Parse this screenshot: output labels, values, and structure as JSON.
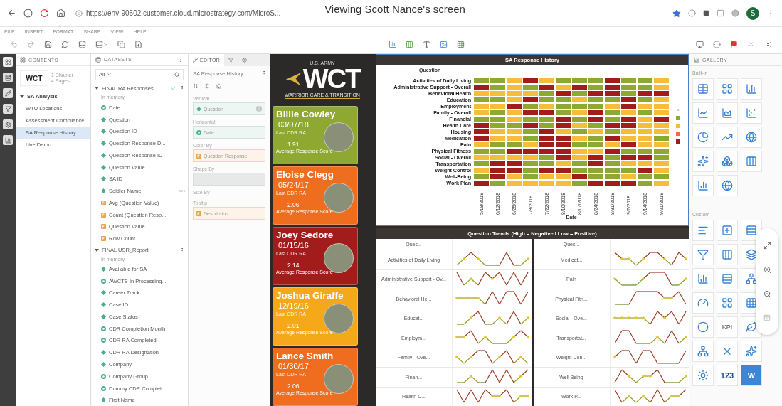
{
  "browser": {
    "url": "https://env-90502.customer.cloud.microstrategy.com/MicroS...",
    "share_banner": "Viewing Scott Nance's screen",
    "avatar": "S"
  },
  "menu": [
    "FILE",
    "INSERT",
    "FORMAT",
    "SHARE",
    "VIEW",
    "HELP"
  ],
  "contents": {
    "title": "CONTENTS",
    "thumbnail_text": "WCT",
    "chapters": "1 Chapter",
    "pages": "4 Pages",
    "tree": [
      {
        "label": "SA Analysis",
        "expanded": true,
        "selected": false,
        "children": [
          {
            "label": "WTU Locations",
            "selected": false
          },
          {
            "label": "Assessment Compliance",
            "selected": false
          },
          {
            "label": "SA Response History",
            "selected": true
          },
          {
            "label": "Live Demo",
            "selected": false
          }
        ]
      }
    ]
  },
  "datasets": {
    "title": "DATASETS",
    "filter": "All",
    "groups": [
      {
        "name": "FINAL RA Responses",
        "status": "In memory",
        "expanded": true,
        "in_use": true,
        "children": [
          {
            "label": "Date",
            "kind": "derived",
            "hovered": false
          },
          {
            "label": "Question",
            "kind": "attribute",
            "hovered": false
          },
          {
            "label": "Question ID",
            "kind": "attribute",
            "hovered": false
          },
          {
            "label": "Question Response D...",
            "kind": "attribute",
            "hovered": false
          },
          {
            "label": "Question Response ID",
            "kind": "attribute",
            "hovered": false
          },
          {
            "label": "Question Value",
            "kind": "attribute",
            "hovered": false
          },
          {
            "label": "SA ID",
            "kind": "attribute",
            "hovered": false
          },
          {
            "label": "Soldier Name",
            "kind": "attribute",
            "hovered": true
          },
          {
            "label": "Avg (Question Value)",
            "kind": "metric",
            "hovered": false
          },
          {
            "label": "Count (Question Resp...",
            "kind": "metric",
            "hovered": false
          },
          {
            "label": "Question Value",
            "kind": "metric",
            "hovered": false
          },
          {
            "label": "Row Count",
            "kind": "metric",
            "hovered": false
          }
        ]
      },
      {
        "name": "FINAL USR_Report",
        "status": "In memory",
        "expanded": true,
        "in_use": false,
        "children": [
          {
            "label": "Available for SA",
            "kind": "attribute",
            "hovered": false
          },
          {
            "label": "AWCTS In Processing...",
            "kind": "derived",
            "hovered": false
          },
          {
            "label": "Career Track",
            "kind": "attribute",
            "hovered": false
          },
          {
            "label": "Case ID",
            "kind": "attribute",
            "hovered": false
          },
          {
            "label": "Case Status",
            "kind": "attribute",
            "hovered": false
          },
          {
            "label": "CDR Completion Month",
            "kind": "derived",
            "hovered": false
          },
          {
            "label": "CDR RA Completed",
            "kind": "derived",
            "hovered": false
          },
          {
            "label": "CDR RA Designation",
            "kind": "attribute",
            "hovered": false
          },
          {
            "label": "Company",
            "kind": "attribute",
            "hovered": false
          },
          {
            "label": "Company Group",
            "kind": "derived",
            "hovered": false
          },
          {
            "label": "Dummy CDR Complet...",
            "kind": "derived",
            "hovered": false
          },
          {
            "label": "First Name",
            "kind": "attribute",
            "hovered": false
          }
        ]
      }
    ]
  },
  "editor": {
    "tab": "EDITOR",
    "viz_name": "SA Response History",
    "zones": [
      {
        "label": "Vertical",
        "kind": "attribute",
        "value": "Question"
      },
      {
        "label": "Horizontal",
        "kind": "derived",
        "value": "Date"
      },
      {
        "label": "Color By",
        "kind": "metric",
        "value": "Question Response"
      },
      {
        "label": "Shape By",
        "kind": "empty"
      },
      {
        "label": "Size By",
        "kind": "none"
      },
      {
        "label": "Tooltip",
        "kind": "metric",
        "value": "Description"
      }
    ]
  },
  "logo": {
    "top": "U.S. ARMY",
    "mark": "WCT",
    "bottom": "WARRIOR CARE & TRANSITION"
  },
  "cards": [
    {
      "name": "Billie Cowley",
      "date": "03/07/18",
      "date_label": "Last CDR RA",
      "score": "1.91",
      "score_label": "Average Response Score",
      "color": "#8fa832"
    },
    {
      "name": "Eloise Clegg",
      "date": "05/24/17",
      "date_label": "Last CDR RA",
      "score": "2.06",
      "score_label": "Average Response Score",
      "color": "#ee6d1e"
    },
    {
      "name": "Joey Sedore",
      "date": "01/15/16",
      "date_label": "Last CDR RA",
      "score": "2.14",
      "score_label": "Average Response Score",
      "color": "#a21c1c"
    },
    {
      "name": "Joshua Giraffe",
      "date": "12/19/16",
      "date_label": "Last CDR RA",
      "score": "2.01",
      "score_label": "Average Response Score",
      "color": "#f4a81a"
    },
    {
      "name": "Lance Smith",
      "date": "01/30/17",
      "date_label": "Last CDR RA",
      "score": "2.06",
      "score_label": "Average Response Score",
      "color": "#ee6d1e"
    }
  ],
  "heatmap": {
    "title": "SA Response History",
    "row_header": "Question",
    "x_title": "Date",
    "legend_toggle": "«",
    "legend": [
      {
        "color": "#8fa832"
      },
      {
        "color": "#f6bd3c"
      },
      {
        "color": "#e9742a"
      },
      {
        "color": "#a21c1c"
      }
    ],
    "dates": [
      "5/18/2018",
      "6/12/2018",
      "6/25/2018",
      "7/8/2018",
      "7/22/2018",
      "8/10/2018",
      "8/17/2018",
      "8/24/2018",
      "8/31/2018",
      "9/7/2018",
      "9/14/2018",
      "9/21/2018"
    ],
    "rows": [
      {
        "label": "Activities of Daily Living",
        "cells": [
          {
            "color": "#8fa832"
          },
          {
            "color": "#8fa832"
          },
          {
            "color": "#f6bd3c"
          },
          {
            "color": "#a21c1c"
          },
          {
            "color": "#f6bd3c"
          },
          {
            "color": "#8fa832"
          },
          {
            "color": "#8fa832"
          },
          {
            "color": "#8fa832"
          },
          {
            "color": "#a21c1c"
          },
          {
            "color": "#8fa832"
          },
          {
            "color": "#8fa832"
          },
          {
            "color": "#f6bd3c"
          }
        ]
      },
      {
        "label": "Administrative Support - Overall",
        "cells": [
          {
            "color": "#a21c1c"
          },
          {
            "color": "#8fa832"
          },
          {
            "color": "#f6bd3c"
          },
          {
            "color": "#8fa832"
          },
          {
            "color": "#a21c1c"
          },
          {
            "color": "#f6bd3c"
          },
          {
            "color": "#a21c1c"
          },
          {
            "color": "#8fa832"
          },
          {
            "color": "#a21c1c"
          },
          {
            "color": "#8fa832"
          },
          {
            "color": "#8fa832"
          },
          {
            "color": "#f6bd3c"
          }
        ]
      },
      {
        "label": "Behavioral Health",
        "cells": [
          {
            "color": "#f6bd3c"
          },
          {
            "color": "#f6bd3c"
          },
          {
            "color": "#f6bd3c"
          },
          {
            "color": "#f6bd3c"
          },
          {
            "color": "#8fa832"
          },
          {
            "color": "#a21c1c"
          },
          {
            "color": "#8fa832"
          },
          {
            "color": "#a21c1c"
          },
          {
            "color": "#a21c1c"
          },
          {
            "color": "#8fa832"
          },
          {
            "color": "#a21c1c"
          },
          {
            "color": "#a21c1c"
          }
        ]
      },
      {
        "label": "Education",
        "cells": [
          {
            "color": "#8fa832"
          },
          {
            "color": "#8fa832"
          },
          {
            "color": "#f6bd3c"
          },
          {
            "color": "#a21c1c"
          },
          {
            "color": "#8fa832"
          },
          {
            "color": "#8fa832"
          },
          {
            "color": "#f6bd3c"
          },
          {
            "color": "#8fa832"
          },
          {
            "color": "#8fa832"
          },
          {
            "color": "#a21c1c"
          },
          {
            "color": "#8fa832"
          },
          {
            "color": "#f6bd3c"
          }
        ]
      },
      {
        "label": "Employment",
        "cells": [
          {
            "color": "#f6bd3c"
          },
          {
            "color": "#f6bd3c"
          },
          {
            "color": "#a21c1c"
          },
          {
            "color": "#8fa832"
          },
          {
            "color": "#f6bd3c"
          },
          {
            "color": "#8fa832"
          },
          {
            "color": "#8fa832"
          },
          {
            "color": "#8fa832"
          },
          {
            "color": "#f6bd3c"
          },
          {
            "color": "#a21c1c"
          },
          {
            "color": "#f6bd3c"
          },
          {
            "color": "#f6bd3c"
          }
        ]
      },
      {
        "label": "Family - Overall",
        "cells": [
          {
            "color": "#f6bd3c"
          },
          {
            "color": "#8fa832"
          },
          {
            "color": "#f6bd3c"
          },
          {
            "color": "#a21c1c"
          },
          {
            "color": "#a21c1c"
          },
          {
            "color": "#8fa832"
          },
          {
            "color": "#f6bd3c"
          },
          {
            "color": "#a21c1c"
          },
          {
            "color": "#8fa832"
          },
          {
            "color": "#f6bd3c"
          },
          {
            "color": "#8fa832"
          },
          {
            "color": "#f6bd3c"
          }
        ]
      },
      {
        "label": "Financial",
        "cells": [
          {
            "color": "#8fa832"
          },
          {
            "color": "#8fa832"
          },
          {
            "color": "#f6bd3c"
          },
          {
            "color": "#8fa832"
          },
          {
            "color": "#8fa832"
          },
          {
            "color": "#a21c1c"
          },
          {
            "color": "#8fa832"
          },
          {
            "color": "#a21c1c"
          },
          {
            "color": "#8fa832"
          },
          {
            "color": "#a21c1c"
          },
          {
            "color": "#f6bd3c"
          },
          {
            "color": "#a21c1c"
          }
        ]
      },
      {
        "label": "Health Care",
        "cells": [
          {
            "color": "#a21c1c"
          },
          {
            "color": "#8fa832"
          },
          {
            "color": "#8fa832"
          },
          {
            "color": "#a21c1c"
          },
          {
            "color": "#8fa832"
          },
          {
            "color": "#a21c1c"
          },
          {
            "color": "#f6bd3c"
          },
          {
            "color": "#8fa832"
          },
          {
            "color": "#a21c1c"
          },
          {
            "color": "#a21c1c"
          },
          {
            "color": "#f6bd3c"
          },
          {
            "color": "#f6bd3c"
          }
        ]
      },
      {
        "label": "Housing",
        "cells": [
          {
            "color": "#a21c1c"
          },
          {
            "color": "#f6bd3c"
          },
          {
            "color": "#f6bd3c"
          },
          {
            "color": "#8fa832"
          },
          {
            "color": "#a21c1c"
          },
          {
            "color": "#f6bd3c"
          },
          {
            "color": "#8fa832"
          },
          {
            "color": "#f6bd3c"
          },
          {
            "color": "#8fa832"
          },
          {
            "color": "#f6bd3c"
          },
          {
            "color": "#f6bd3c"
          },
          {
            "color": "#f6bd3c"
          }
        ]
      },
      {
        "label": "Medication",
        "cells": [
          {
            "color": "#a21c1c"
          },
          {
            "color": "#f6bd3c"
          },
          {
            "color": "#f6bd3c"
          },
          {
            "color": "#8fa832"
          },
          {
            "color": "#a21c1c"
          },
          {
            "color": "#a21c1c"
          },
          {
            "color": "#f6bd3c"
          },
          {
            "color": "#8fa832"
          },
          {
            "color": "#a21c1c"
          },
          {
            "color": "#f6bd3c"
          },
          {
            "color": "#f6bd3c"
          },
          {
            "color": "#8fa832"
          }
        ]
      },
      {
        "label": "Pain",
        "cells": [
          {
            "color": "#f6bd3c"
          },
          {
            "color": "#8fa832"
          },
          {
            "color": "#8fa832"
          },
          {
            "color": "#f6bd3c"
          },
          {
            "color": "#a21c1c"
          },
          {
            "color": "#a21c1c"
          },
          {
            "color": "#8fa832"
          },
          {
            "color": "#8fa832"
          },
          {
            "color": "#f6bd3c"
          },
          {
            "color": "#a21c1c"
          },
          {
            "color": "#f6bd3c"
          },
          {
            "color": "#f6bd3c"
          }
        ]
      },
      {
        "label": "Physical Fitness",
        "cells": [
          {
            "color": "#8fa832"
          },
          {
            "color": "#8fa832"
          },
          {
            "color": "#a21c1c"
          },
          {
            "color": "#a21c1c"
          },
          {
            "color": "#a21c1c"
          },
          {
            "color": "#a21c1c"
          },
          {
            "color": "#f6bd3c"
          },
          {
            "color": "#f6bd3c"
          },
          {
            "color": "#a21c1c"
          },
          {
            "color": "#8fa832"
          },
          {
            "color": "#8fa832"
          },
          {
            "color": "#8fa832"
          }
        ]
      },
      {
        "label": "Social - Overall",
        "cells": [
          {
            "color": "#f6bd3c"
          },
          {
            "color": "#f6bd3c"
          },
          {
            "color": "#f6bd3c"
          },
          {
            "color": "#f6bd3c"
          },
          {
            "color": "#8fa832"
          },
          {
            "color": "#a21c1c"
          },
          {
            "color": "#f6bd3c"
          },
          {
            "color": "#a21c1c"
          },
          {
            "color": "#8fa832"
          },
          {
            "color": "#a21c1c"
          },
          {
            "color": "#a21c1c"
          },
          {
            "color": "#8fa832"
          }
        ]
      },
      {
        "label": "Transportation",
        "cells": [
          {
            "color": "#8fa832"
          },
          {
            "color": "#a21c1c"
          },
          {
            "color": "#a21c1c"
          },
          {
            "color": "#8fa832"
          },
          {
            "color": "#8fa832"
          },
          {
            "color": "#f6bd3c"
          },
          {
            "color": "#8fa832"
          },
          {
            "color": "#a21c1c"
          },
          {
            "color": "#8fa832"
          },
          {
            "color": "#f6bd3c"
          },
          {
            "color": "#f6bd3c"
          },
          {
            "color": "#f6bd3c"
          }
        ]
      },
      {
        "label": "Weight Control",
        "cells": [
          {
            "color": "#f6bd3c"
          },
          {
            "color": "#a21c1c"
          },
          {
            "color": "#a21c1c"
          },
          {
            "color": "#8fa832"
          },
          {
            "color": "#a21c1c"
          },
          {
            "color": "#a21c1c"
          },
          {
            "color": "#8fa832"
          },
          {
            "color": "#8fa832"
          },
          {
            "color": "#8fa832"
          },
          {
            "color": "#8fa832"
          },
          {
            "color": "#a21c1c"
          },
          {
            "color": "#f6bd3c"
          }
        ]
      },
      {
        "label": "Well-Being",
        "cells": [
          {
            "color": "#8fa832"
          },
          {
            "color": "#a21c1c"
          },
          {
            "color": "#f6bd3c"
          },
          {
            "color": "#8fa832"
          },
          {
            "color": "#f6bd3c"
          },
          {
            "color": "#f6bd3c"
          },
          {
            "color": "#a21c1c"
          },
          {
            "color": "#8fa832"
          },
          {
            "color": "#8fa832"
          },
          {
            "color": "#f6bd3c"
          },
          {
            "color": "#8fa832"
          },
          {
            "color": "#8fa832"
          }
        ]
      },
      {
        "label": "Work Plan",
        "cells": [
          {
            "color": "#a21c1c"
          },
          {
            "color": "#8fa832"
          },
          {
            "color": "#f6bd3c"
          },
          {
            "color": "#f6bd3c"
          },
          {
            "color": "#f6bd3c"
          },
          {
            "color": "#f6bd3c"
          },
          {
            "color": "#8fa832"
          },
          {
            "color": "#a21c1c"
          },
          {
            "color": "#a21c1c"
          },
          {
            "color": "#a21c1c"
          },
          {
            "color": "#8fa832"
          },
          {
            "color": "#f6bd3c"
          }
        ]
      }
    ]
  },
  "trends": {
    "title": "Question Trends (High = Negative I Low = Positive)",
    "columns": [
      {
        "header": "Ques...",
        "rows": [
          "Activities of Daily Living",
          "Administrative Support - Ov...",
          "Behavioral He...",
          "Educat...",
          "Employm...",
          "Family - Ove...",
          "Finan...",
          "Health C..."
        ]
      },
      {
        "header": "Ques...",
        "rows": [
          "Medicat...",
          "Pain",
          "Physical Fitn...",
          "Social - Ove...",
          "Transportat...",
          "Weight Con...",
          "Well Being",
          "Work P..."
        ]
      }
    ]
  },
  "gallery": {
    "title": "GALLERY",
    "builtin_label": "Built-in",
    "custom_label": "Custom",
    "builtin": [
      {
        "kind": "icon"
      },
      {
        "kind": "icon"
      },
      {
        "kind": "icon"
      },
      {
        "kind": "icon"
      },
      {
        "kind": "icon"
      },
      {
        "kind": "icon"
      },
      {
        "kind": "icon"
      },
      {
        "kind": "icon"
      },
      {
        "kind": "icon"
      },
      {
        "kind": "icon"
      },
      {
        "kind": "icon"
      },
      {
        "kind": "icon"
      },
      {
        "kind": "icon"
      },
      {
        "kind": "icon"
      }
    ],
    "custom": [
      {
        "kind": "icon"
      },
      {
        "kind": "icon"
      },
      {
        "kind": "icon"
      },
      {
        "kind": "icon"
      },
      {
        "kind": "icon"
      },
      {
        "kind": "icon"
      },
      {
        "kind": "icon"
      },
      {
        "kind": "icon"
      },
      {
        "kind": "icon"
      },
      {
        "kind": "icon"
      },
      {
        "kind": "icon"
      },
      {
        "kind": "icon"
      },
      {
        "kind": "icon"
      },
      {
        "kind": "text",
        "label": "KPI"
      },
      {
        "kind": "icon"
      },
      {
        "kind": "icon"
      },
      {
        "kind": "icon"
      },
      {
        "kind": "icon"
      },
      {
        "kind": "icon"
      },
      {
        "kind": "text",
        "label": "123"
      },
      {
        "kind": "text",
        "label": "W"
      }
    ]
  }
}
